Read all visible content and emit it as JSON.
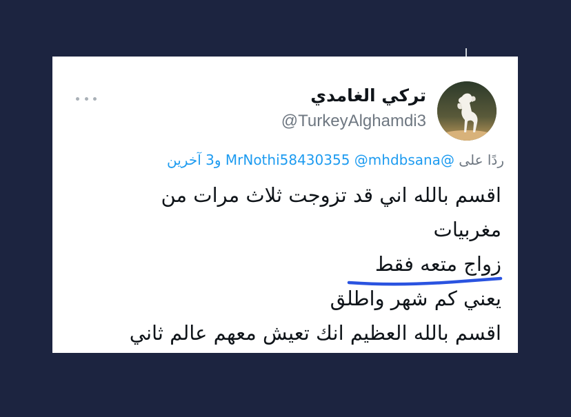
{
  "tweet": {
    "display_name": "تركي الغامدي",
    "handle": "@TurkeyAlghamdi3",
    "reply_prefix": "ردًا على",
    "mentions": [
      "@MrNothi58430355",
      "@mhdbsana"
    ],
    "others": "و3 آخرين",
    "lines": [
      "اقسم بالله اني قد تزوجت ثلاث مرات من",
      "مغربيات",
      "زواج متعه فقط",
      "يعني كم شهر واطلق",
      "اقسم بالله العظيم انك تعيش معهم عالم ثاني"
    ]
  },
  "icons": {
    "more": "more-horizontal-icon",
    "avatar": "white-horse-avatar"
  },
  "colors": {
    "background": "#1c2440",
    "mention": "#1d9bf0",
    "underline": "#2a53e0",
    "text": "#0f1419",
    "muted": "#6e7781"
  }
}
